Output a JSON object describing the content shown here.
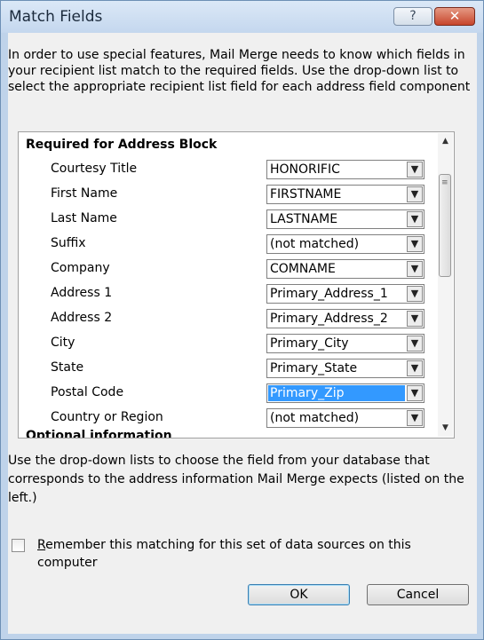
{
  "window": {
    "title": "Match Fields",
    "help_glyph": "?",
    "close_glyph": "✕"
  },
  "intro_text": "In order to use special features, Mail Merge needs to know which fields in your recipient list match to the required fields.  Use the drop-down list to select the appropriate recipient list field for each address field component",
  "list": {
    "section_required": "Required for Address Block",
    "section_optional": "Optional information",
    "rows": [
      {
        "label": "Courtesy Title",
        "value": "HONORIFIC"
      },
      {
        "label": "First Name",
        "value": "FIRSTNAME"
      },
      {
        "label": "Last Name",
        "value": "LASTNAME"
      },
      {
        "label": "Suffix",
        "value": "(not matched)"
      },
      {
        "label": "Company",
        "value": "COMNAME"
      },
      {
        "label": "Address 1",
        "value": "Primary_Address_1"
      },
      {
        "label": "Address 2",
        "value": "Primary_Address_2"
      },
      {
        "label": "City",
        "value": "Primary_City"
      },
      {
        "label": "State",
        "value": "Primary_State"
      },
      {
        "label": "Postal Code",
        "value": "Primary_Zip"
      },
      {
        "label": "Country or Region",
        "value": "(not matched)"
      }
    ],
    "selected_row": "Postal Code",
    "dropdown_glyph": "▼",
    "scroll_up_glyph": "▲",
    "scroll_down_glyph": "▼",
    "grip_glyph": "≡"
  },
  "hint_text": "Use the drop-down lists to choose the field from your database that corresponds to the address information Mail Merge expects (listed on the left.)",
  "remember": {
    "checked": false,
    "label_first": "R",
    "label_rest": "emember this matching for this set of data sources on this computer"
  },
  "buttons": {
    "ok": "OK",
    "cancel": "Cancel"
  },
  "colors": {
    "selection": "#3399ff",
    "titlebar": "#c4d7ee",
    "close_button": "#c7452c"
  }
}
